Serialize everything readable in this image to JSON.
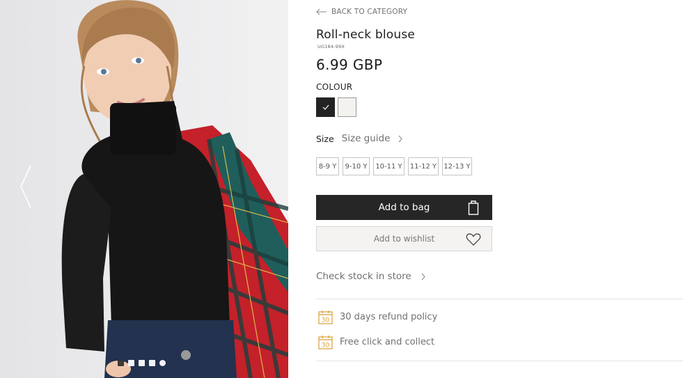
{
  "gallery": {
    "slide_count": 5,
    "active_index": 0
  },
  "nav": {
    "back_label": "BACK TO CATEGORY"
  },
  "product": {
    "title": "Roll-neck blouse",
    "sku": "UG184-99X",
    "price": "6.99 GBP"
  },
  "colour": {
    "label": "COLOUR",
    "options": [
      {
        "name": "black",
        "hex": "#232323",
        "selected": true
      },
      {
        "name": "cream",
        "hex": "#f4f2ee",
        "selected": false
      }
    ]
  },
  "size": {
    "label": "Size",
    "guide_label": "Size guide",
    "options": [
      "8-9 Y",
      "9-10 Y",
      "10-11 Y",
      "11-12 Y",
      "12-13 Y"
    ]
  },
  "actions": {
    "add_to_bag": "Add to bag",
    "add_to_wishlist": "Add to wishlist"
  },
  "store": {
    "check_stock": "Check stock in store"
  },
  "benefits": [
    {
      "icon": "calendar-30-icon",
      "badge": "30",
      "text": "30 days refund policy"
    },
    {
      "icon": "calendar-30-icon",
      "badge": "30",
      "text": "Free click and collect"
    }
  ],
  "colors": {
    "accent": "#d8a13a",
    "button_dark": "#262626",
    "muted_text": "#707070"
  }
}
